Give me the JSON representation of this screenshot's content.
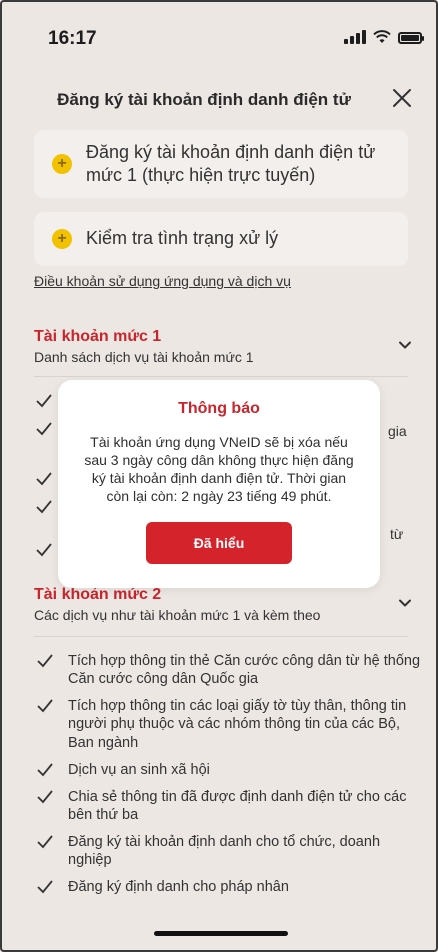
{
  "status_bar": {
    "time": "16:17"
  },
  "header": {
    "title": "Đăng ký tài khoản định danh điện tử"
  },
  "actions": [
    {
      "label": "Đăng ký tài khoản định danh điện tử mức 1 (thực hiện trực tuyến)"
    },
    {
      "label": "Kiểm tra tình trạng xử lý"
    }
  ],
  "terms_link": "Điều khoản sử dụng ứng dụng và dịch vụ",
  "level1": {
    "title": "Tài khoản mức 1",
    "subtitle": "Danh sách dịch vụ tài khoản mức 1",
    "partial_texts": [
      "gia",
      "từ"
    ]
  },
  "level2": {
    "title": "Tài khoản mức 2",
    "subtitle": "Các dịch vụ như tài khoản mức 1 và kèm theo",
    "items": [
      "Tích hợp thông tin thẻ Căn cước công dân từ hệ thống Căn cước công dân Quốc gia",
      "Tích hợp thông tin các loại giấy tờ tùy thân, thông tin người phụ thuộc và các nhóm thông tin của các Bộ, Ban ngành",
      "Dịch vụ an sinh xã hội",
      "Chia sẻ thông tin đã được định danh điện tử cho các bên thứ ba",
      "Đăng ký tài khoản định danh cho tổ chức, doanh nghiệp",
      "Đăng ký định danh cho pháp nhân"
    ]
  },
  "modal": {
    "title": "Thông báo",
    "message": "Tài khoản ứng dụng VNeID sẽ bị xóa nếu sau 3 ngày công dân không thực hiện đăng ký tài khoản định danh điện tử. Thời gian còn lại còn: 2 ngày 23 tiếng 49 phút.",
    "button_label": "Đã hiểu"
  },
  "colors": {
    "accent_red": "#c8252c",
    "button_red": "#d4232b",
    "plus_yellow": "#f2c200"
  },
  "icons": [
    "signal-icon",
    "wifi-icon",
    "battery-icon",
    "close-icon",
    "plus-icon",
    "chevron-down-icon",
    "check-icon"
  ]
}
